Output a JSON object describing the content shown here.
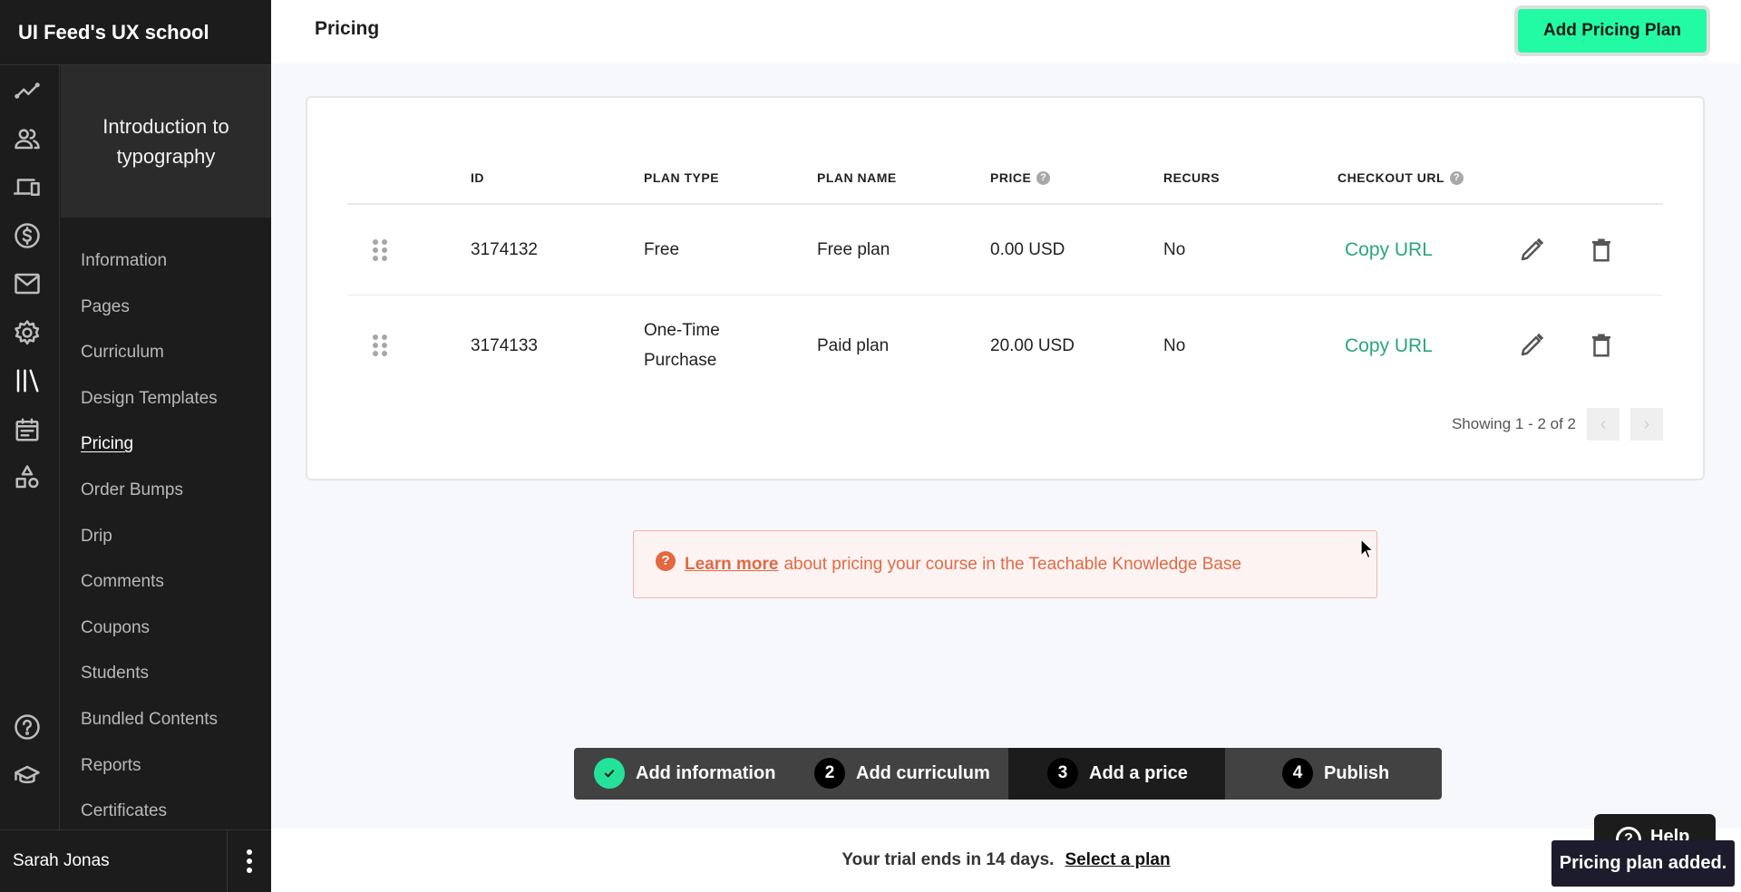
{
  "sidebar": {
    "brand": "UI Feed's UX school",
    "course_title": "Introduction to typography",
    "rail_icons": [
      "analytics-icon",
      "users-icon",
      "devices-icon",
      "sales-icon",
      "email-icon",
      "settings-icon",
      "library-icon",
      "calendar-icon",
      "shapes-icon"
    ],
    "rail_bottom_icons": [
      "help-circle-icon",
      "graduation-cap-icon"
    ],
    "nav": [
      {
        "label": "Information"
      },
      {
        "label": "Pages"
      },
      {
        "label": "Curriculum"
      },
      {
        "label": "Design Templates"
      },
      {
        "label": "Pricing",
        "active": true
      },
      {
        "label": "Order Bumps"
      },
      {
        "label": "Drip"
      },
      {
        "label": "Comments"
      },
      {
        "label": "Coupons"
      },
      {
        "label": "Students"
      },
      {
        "label": "Bundled Contents"
      },
      {
        "label": "Reports"
      },
      {
        "label": "Certificates"
      }
    ],
    "user_name": "Sarah Jonas"
  },
  "header": {
    "title": "Pricing",
    "add_button": "Add Pricing Plan"
  },
  "table": {
    "columns": {
      "id": "ID",
      "plan_type": "PLAN TYPE",
      "plan_name": "PLAN NAME",
      "price": "PRICE",
      "recurs": "RECURS",
      "checkout_url": "CHECKOUT URL"
    },
    "help_glyph": "?",
    "rows": [
      {
        "id": "3174132",
        "plan_type": "Free",
        "plan_name": "Free plan",
        "price": "0.00 USD",
        "recurs": "No",
        "checkout": "Copy URL"
      },
      {
        "id": "3174133",
        "plan_type": "One-Time Purchase",
        "plan_name": "Paid plan",
        "price": "20.00 USD",
        "recurs": "No",
        "checkout": "Copy URL"
      }
    ],
    "pagination": {
      "info": "Showing 1 - 2 of 2",
      "prev": "‹",
      "next": "›"
    }
  },
  "banner": {
    "icon": "?",
    "link": "Learn more",
    "text": "about pricing your course in the Teachable Knowledge Base"
  },
  "stepper": {
    "steps": [
      {
        "num": "",
        "label": "Add information",
        "state": "done"
      },
      {
        "num": "2",
        "label": "Add curriculum",
        "state": "todo"
      },
      {
        "num": "3",
        "label": "Add a price",
        "state": "current"
      },
      {
        "num": "4",
        "label": "Publish",
        "state": "todo"
      }
    ]
  },
  "trial": {
    "text": "Your trial ends in 14 days.",
    "link": "Select a plan"
  },
  "help_button": {
    "glyph": "?",
    "label": "Help"
  },
  "toast": "Pricing plan added.",
  "colors": {
    "accent_green": "#22fba3",
    "link_green": "#2ba57e",
    "warning_orange": "#e16a44",
    "sidebar_bg": "#1c1c1c"
  }
}
